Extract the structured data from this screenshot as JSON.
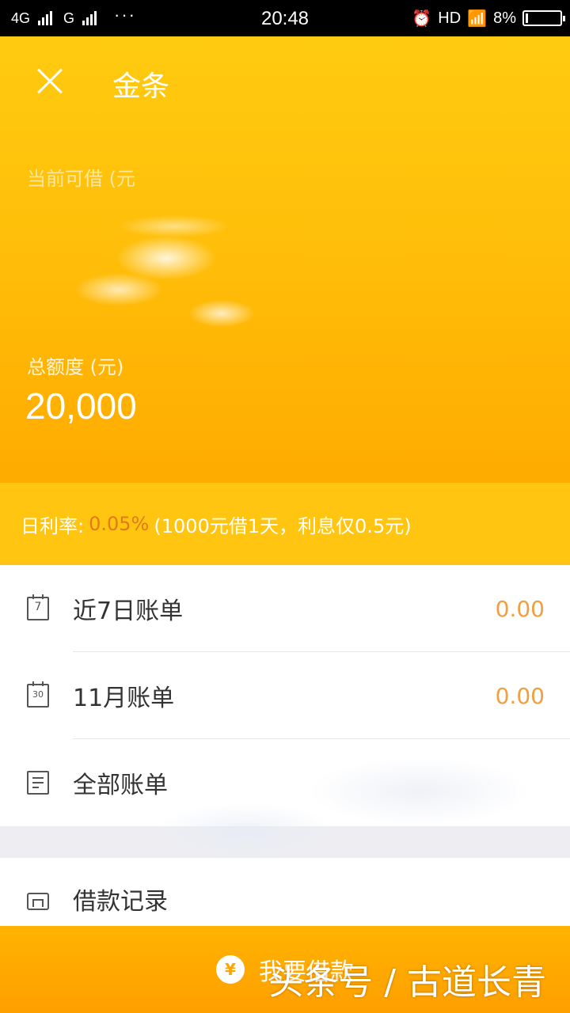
{
  "status_bar": {
    "network1": "4G",
    "network2": "G",
    "time": "20:48",
    "hd": "HD",
    "battery": "8%",
    "battery_level": 0.08
  },
  "header": {
    "title": "金条",
    "available_label": "当前可借 (元",
    "total_label": "总额度 (元)",
    "total_value": "20,000"
  },
  "rate": {
    "label": "日利率:",
    "value": "0.05%",
    "note": "(1000元借1天，利息仅0.5元)"
  },
  "list": {
    "items": [
      {
        "label": "近7日账单",
        "amount": "0.00",
        "icon_text": "7"
      },
      {
        "label": "11月账单",
        "amount": "0.00",
        "icon_text": "30"
      },
      {
        "label": "全部账单"
      },
      {
        "label": "借款记录"
      }
    ]
  },
  "bottom": {
    "button_label": "我要借款",
    "coin_symbol": "¥",
    "watermark": "头条号 / 古道长青"
  },
  "colors": {
    "brand_yellow": "#ffc510",
    "accent_amount": "#f0a040",
    "rate_value": "#e07a1a",
    "button_orange": "#ffa500"
  }
}
